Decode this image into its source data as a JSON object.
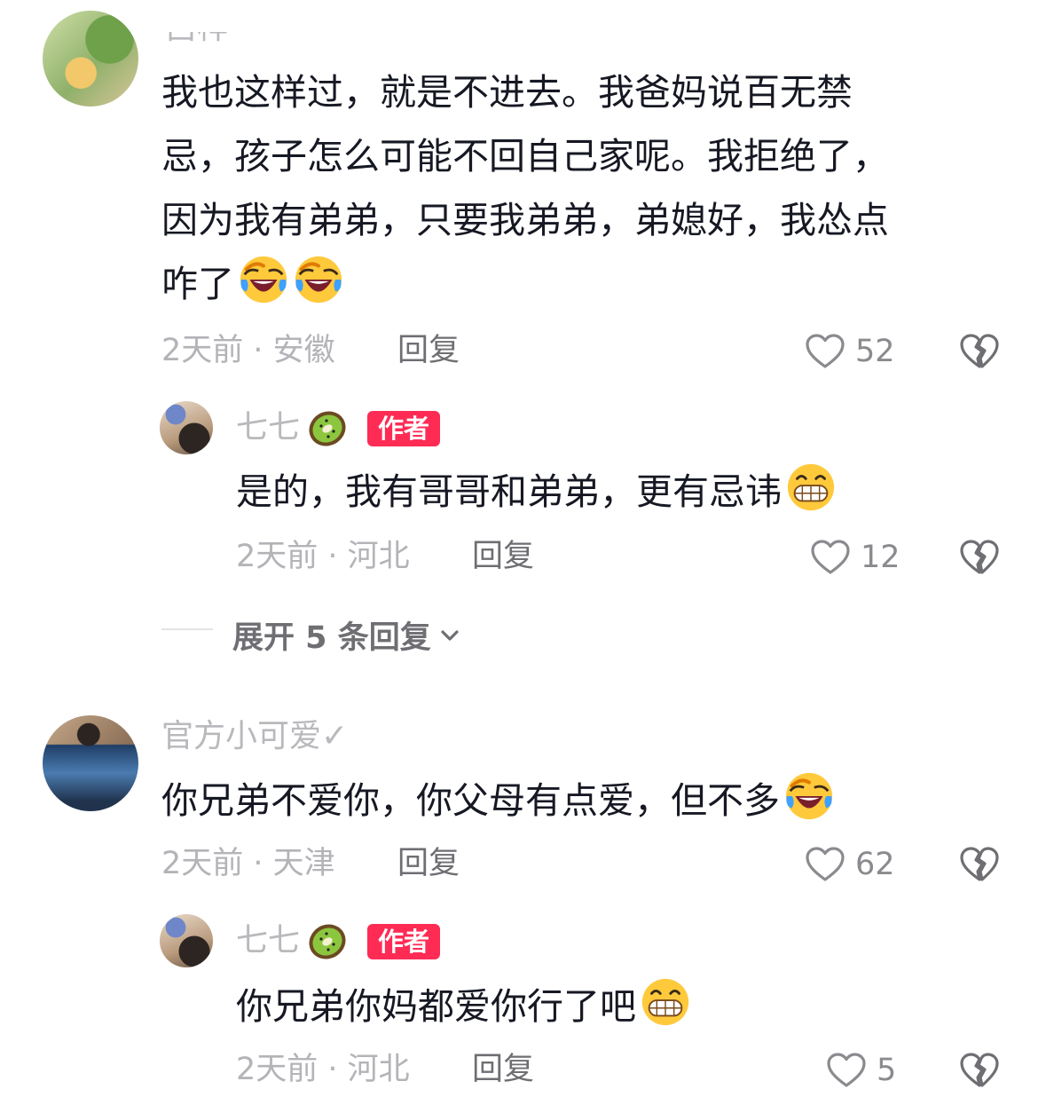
{
  "comments": [
    {
      "username": "吕梓",
      "text_lines": [
        "我也这样过，就是不进去。我爸妈说百无禁",
        "忌，孩子怎么可能不回自己家呢。我拒绝了，",
        "因为我有弟弟，只要我弟弟，弟媳好，我怂点",
        "咋了"
      ],
      "meta": "2天前 · 安徽",
      "reply": "回复",
      "likes": "52",
      "replies": [
        {
          "username": "七七",
          "badge": "作者",
          "text": "是的，我有哥哥和弟弟，更有忌讳",
          "meta": "2天前 · 河北",
          "reply": "回复",
          "likes": "12"
        }
      ],
      "expand_label": "展开 5 条回复"
    },
    {
      "username": "官方小可爱✓",
      "text": "你兄弟不爱你，你父母有点爱，但不多",
      "meta": "2天前 · 天津",
      "reply": "回复",
      "likes": "62",
      "replies": [
        {
          "username": "七七",
          "badge": "作者",
          "text": "你兄弟你妈都爱你行了吧",
          "meta": "2天前 · 河北",
          "reply": "回复",
          "likes": "5"
        }
      ]
    }
  ],
  "icons": {
    "like": "heart-outline-icon",
    "dislike": "broken-heart-icon",
    "expand": "chevron-down-icon",
    "emoji_laugh": "laughing-tears-emoji",
    "emoji_grin": "grinning-emoji",
    "kiwi": "kiwi-emoji"
  },
  "colors": {
    "badge": "#fe2c55",
    "text": "#161823",
    "muted": "#b3b3b8"
  }
}
